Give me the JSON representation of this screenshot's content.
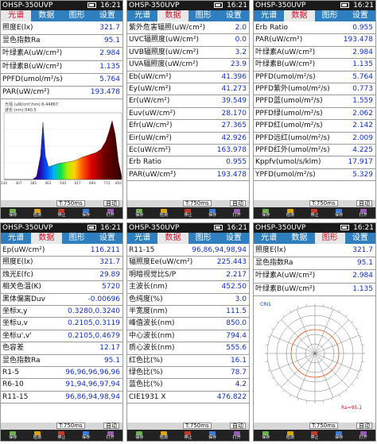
{
  "device": "OHSP-350UVP",
  "time": "16:21",
  "tabs": [
    "光谱",
    "数据",
    "图形",
    "设置"
  ],
  "status": {
    "int_time": "T:750ms",
    "auto": "自动"
  },
  "buttons": [
    "保存",
    "检测",
    "停止",
    "保存",
    "打开"
  ],
  "screen1": {
    "rows": [
      {
        "label": "照度E(lx)",
        "value": "321.7"
      },
      {
        "label": "显色指数Ra",
        "value": "95.1"
      },
      {
        "label": "叶绿素A(uW/cm²)",
        "value": "2.984"
      },
      {
        "label": "叶绿素B(uW/cm²)",
        "value": "1.135"
      },
      {
        "label": "PPFD(umol/m²/s)",
        "value": "5.764"
      },
      {
        "label": "PAR(uW/cm²)",
        "value": "193.478"
      }
    ],
    "spectrum": {
      "info1": "光强 (uW/cm²/nm):6.44867",
      "info2": "波长 (nm):540.5",
      "x_ticks": [
        "230",
        "307",
        "385",
        "462",
        "540",
        "617",
        "694",
        "772",
        "850"
      ]
    }
  },
  "screen2": {
    "rows": [
      {
        "label": "紫外危害辐照(uW/cm²)",
        "value": "2.0"
      },
      {
        "label": "UVC辐照度(uW/cm²)",
        "value": "0.0"
      },
      {
        "label": "UVB辐照度(uW/cm²)",
        "value": "3.2"
      },
      {
        "label": "UVA辐照度(uW/cm²)",
        "value": "23.9"
      },
      {
        "label": "Eb(uW/cm²)",
        "value": "41.396"
      },
      {
        "label": "Ey(uW/cm²)",
        "value": "41.273"
      },
      {
        "label": "Er(uW/cm²)",
        "value": "39.549"
      },
      {
        "label": "Euv(uW/cm²)",
        "value": "28.170"
      },
      {
        "label": "Efr(uW/cm²)",
        "value": "27.365"
      },
      {
        "label": "Eir(uW/cm²)",
        "value": "42.926"
      },
      {
        "label": "Ec(uW/cm²)",
        "value": "163.978"
      },
      {
        "label": "Erb Ratio",
        "value": "0.955"
      },
      {
        "label": "PAR(uW/cm²)",
        "value": "193.478"
      }
    ]
  },
  "screen3": {
    "rows": [
      {
        "label": "Erb Ratio",
        "value": "0.955"
      },
      {
        "label": "PAR(uW/cm²)",
        "value": "193.478"
      },
      {
        "label": "叶绿素A(uW/cm²)",
        "value": "2.984"
      },
      {
        "label": "叶绿素B(uW/cm²)",
        "value": "1.135"
      },
      {
        "label": "PPFD(umol/m²/s)",
        "value": "5.764"
      },
      {
        "label": "PPFD紫外(umol/m²/s)",
        "value": "0.773"
      },
      {
        "label": "PPFD蓝(umol/m²/s)",
        "value": "1.559"
      },
      {
        "label": "PPFD绿(umol/m²/s)",
        "value": "2.062"
      },
      {
        "label": "PPFD红(umol/m²/s)",
        "value": "2.142"
      },
      {
        "label": "PPFD远红(umol/m²/s)",
        "value": "2.009"
      },
      {
        "label": "PPFD红外(umol/m²/s)",
        "value": "4.225"
      },
      {
        "label": "Kppfv(umol/s/klm)",
        "value": "17.917"
      },
      {
        "label": "YPFD(umol/m²/s)",
        "value": "5.329"
      }
    ]
  },
  "screen4": {
    "rows": [
      {
        "label": "Ep(uW/cm²)",
        "value": "116.211"
      },
      {
        "label": "照度E(lx)",
        "value": "321.7"
      },
      {
        "label": "烛光E(fc)",
        "value": "29.89"
      },
      {
        "label": "相关色温(K)",
        "value": "5720"
      },
      {
        "label": "黑体偏离Duv",
        "value": "-0.00696"
      },
      {
        "label": "坐标x,y",
        "value": "0.3280,0.3240"
      },
      {
        "label": "坐标u,v",
        "value": "0.2105,0.3119"
      },
      {
        "label": "坐标u',v'",
        "value": "0.2105,0.4679"
      },
      {
        "label": "色容差",
        "value": "12.17"
      },
      {
        "label": "显色指数Ra",
        "value": "95.1"
      },
      {
        "label": "R1-5",
        "value": "96,96,96,96,96"
      },
      {
        "label": "R6-10",
        "value": "91,94,96,97,94"
      },
      {
        "label": "R11-15",
        "value": "96,86,94,98,94"
      }
    ]
  },
  "screen5": {
    "rows": [
      {
        "label": "R11-15",
        "value": "96,86,94,98,94"
      },
      {
        "label": "辐照度Ee(uW/cm²)",
        "value": "225.443"
      },
      {
        "label": "明暗视觉比S/P",
        "value": "2.217"
      },
      {
        "label": "主波长(nm)",
        "value": "452.50"
      },
      {
        "label": "色纯度(%)",
        "value": "3.0"
      },
      {
        "label": "半宽度(nm)",
        "value": "111.5"
      },
      {
        "label": "峰值波长(nm)",
        "value": "850.0"
      },
      {
        "label": "中心波长(nm)",
        "value": "794.4"
      },
      {
        "label": "质心波长(nm)",
        "value": "555.6"
      },
      {
        "label": "红色比(%)",
        "value": "16.1"
      },
      {
        "label": "绿色比(%)",
        "value": "78.7"
      },
      {
        "label": "蓝色比(%)",
        "value": "4.2"
      },
      {
        "label": "CIE1931 X",
        "value": "476.822"
      }
    ]
  },
  "screen6": {
    "rows": [
      {
        "label": "照度E(lx)",
        "value": "321.7"
      },
      {
        "label": "显色指数Ra",
        "value": "95.1"
      },
      {
        "label": "叶绿素A(uW/cm²)",
        "value": "2.984"
      },
      {
        "label": "叶绿素B(uW/cm²)",
        "value": "1.135"
      }
    ],
    "polar": {
      "label": "CRI1",
      "ra": "Ra=95.1"
    }
  },
  "colors": {
    "accent": "#2f7fbf",
    "value": "#1030c0",
    "active_tab": "#d0102a"
  }
}
